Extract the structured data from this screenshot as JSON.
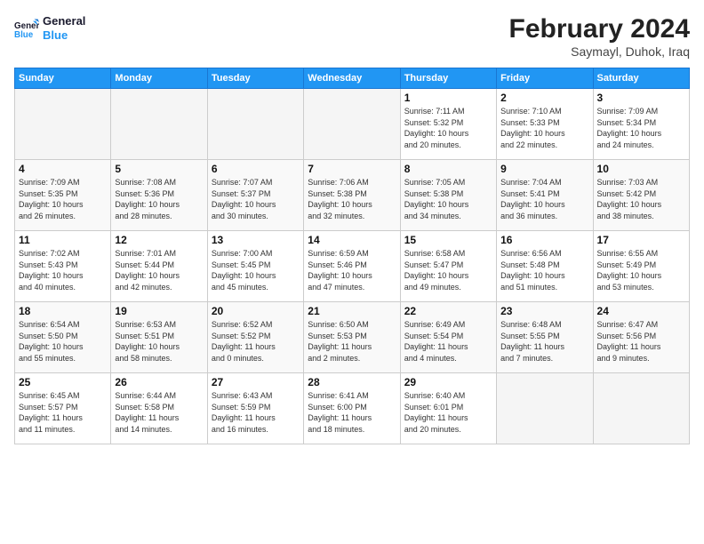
{
  "header": {
    "logo_line1": "General",
    "logo_line2": "Blue",
    "main_title": "February 2024",
    "subtitle": "Saymayl, Duhok, Iraq"
  },
  "weekdays": [
    "Sunday",
    "Monday",
    "Tuesday",
    "Wednesday",
    "Thursday",
    "Friday",
    "Saturday"
  ],
  "weeks": [
    [
      {
        "day": "",
        "info": ""
      },
      {
        "day": "",
        "info": ""
      },
      {
        "day": "",
        "info": ""
      },
      {
        "day": "",
        "info": ""
      },
      {
        "day": "1",
        "info": "Sunrise: 7:11 AM\nSunset: 5:32 PM\nDaylight: 10 hours\nand 20 minutes."
      },
      {
        "day": "2",
        "info": "Sunrise: 7:10 AM\nSunset: 5:33 PM\nDaylight: 10 hours\nand 22 minutes."
      },
      {
        "day": "3",
        "info": "Sunrise: 7:09 AM\nSunset: 5:34 PM\nDaylight: 10 hours\nand 24 minutes."
      }
    ],
    [
      {
        "day": "4",
        "info": "Sunrise: 7:09 AM\nSunset: 5:35 PM\nDaylight: 10 hours\nand 26 minutes."
      },
      {
        "day": "5",
        "info": "Sunrise: 7:08 AM\nSunset: 5:36 PM\nDaylight: 10 hours\nand 28 minutes."
      },
      {
        "day": "6",
        "info": "Sunrise: 7:07 AM\nSunset: 5:37 PM\nDaylight: 10 hours\nand 30 minutes."
      },
      {
        "day": "7",
        "info": "Sunrise: 7:06 AM\nSunset: 5:38 PM\nDaylight: 10 hours\nand 32 minutes."
      },
      {
        "day": "8",
        "info": "Sunrise: 7:05 AM\nSunset: 5:38 PM\nDaylight: 10 hours\nand 34 minutes."
      },
      {
        "day": "9",
        "info": "Sunrise: 7:04 AM\nSunset: 5:41 PM\nDaylight: 10 hours\nand 36 minutes."
      },
      {
        "day": "10",
        "info": "Sunrise: 7:03 AM\nSunset: 5:42 PM\nDaylight: 10 hours\nand 38 minutes."
      }
    ],
    [
      {
        "day": "11",
        "info": "Sunrise: 7:02 AM\nSunset: 5:43 PM\nDaylight: 10 hours\nand 40 minutes."
      },
      {
        "day": "12",
        "info": "Sunrise: 7:01 AM\nSunset: 5:44 PM\nDaylight: 10 hours\nand 42 minutes."
      },
      {
        "day": "13",
        "info": "Sunrise: 7:00 AM\nSunset: 5:45 PM\nDaylight: 10 hours\nand 45 minutes."
      },
      {
        "day": "14",
        "info": "Sunrise: 6:59 AM\nSunset: 5:46 PM\nDaylight: 10 hours\nand 47 minutes."
      },
      {
        "day": "15",
        "info": "Sunrise: 6:58 AM\nSunset: 5:47 PM\nDaylight: 10 hours\nand 49 minutes."
      },
      {
        "day": "16",
        "info": "Sunrise: 6:56 AM\nSunset: 5:48 PM\nDaylight: 10 hours\nand 51 minutes."
      },
      {
        "day": "17",
        "info": "Sunrise: 6:55 AM\nSunset: 5:49 PM\nDaylight: 10 hours\nand 53 minutes."
      }
    ],
    [
      {
        "day": "18",
        "info": "Sunrise: 6:54 AM\nSunset: 5:50 PM\nDaylight: 10 hours\nand 55 minutes."
      },
      {
        "day": "19",
        "info": "Sunrise: 6:53 AM\nSunset: 5:51 PM\nDaylight: 10 hours\nand 58 minutes."
      },
      {
        "day": "20",
        "info": "Sunrise: 6:52 AM\nSunset: 5:52 PM\nDaylight: 11 hours\nand 0 minutes."
      },
      {
        "day": "21",
        "info": "Sunrise: 6:50 AM\nSunset: 5:53 PM\nDaylight: 11 hours\nand 2 minutes."
      },
      {
        "day": "22",
        "info": "Sunrise: 6:49 AM\nSunset: 5:54 PM\nDaylight: 11 hours\nand 4 minutes."
      },
      {
        "day": "23",
        "info": "Sunrise: 6:48 AM\nSunset: 5:55 PM\nDaylight: 11 hours\nand 7 minutes."
      },
      {
        "day": "24",
        "info": "Sunrise: 6:47 AM\nSunset: 5:56 PM\nDaylight: 11 hours\nand 9 minutes."
      }
    ],
    [
      {
        "day": "25",
        "info": "Sunrise: 6:45 AM\nSunset: 5:57 PM\nDaylight: 11 hours\nand 11 minutes."
      },
      {
        "day": "26",
        "info": "Sunrise: 6:44 AM\nSunset: 5:58 PM\nDaylight: 11 hours\nand 14 minutes."
      },
      {
        "day": "27",
        "info": "Sunrise: 6:43 AM\nSunset: 5:59 PM\nDaylight: 11 hours\nand 16 minutes."
      },
      {
        "day": "28",
        "info": "Sunrise: 6:41 AM\nSunset: 6:00 PM\nDaylight: 11 hours\nand 18 minutes."
      },
      {
        "day": "29",
        "info": "Sunrise: 6:40 AM\nSunset: 6:01 PM\nDaylight: 11 hours\nand 20 minutes."
      },
      {
        "day": "",
        "info": ""
      },
      {
        "day": "",
        "info": ""
      }
    ]
  ]
}
